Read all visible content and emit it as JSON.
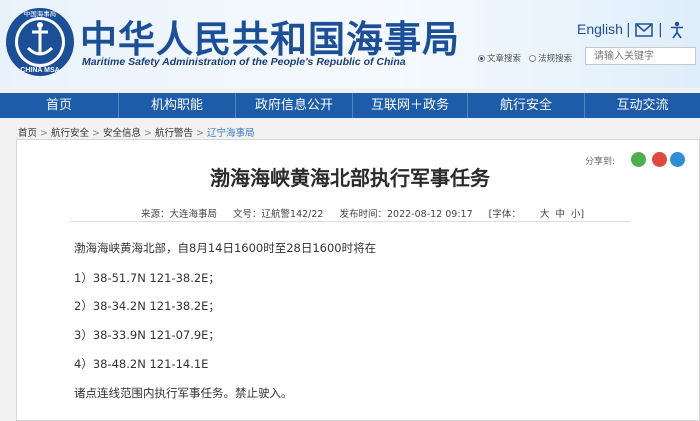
{
  "header": {
    "logo_text": "CHINA MSA",
    "logo_cn": "中国海事局",
    "title_cn": "中华人民共和国海事局",
    "title_en": "Maritime Safety Administration of the People's Republic of China",
    "lang_label": "English",
    "separator": "|",
    "search": {
      "option_fulltext": "文章搜索",
      "option_regulations": "法规搜索",
      "placeholder": "请输入关键字"
    }
  },
  "nav": {
    "items": [
      "首页",
      "机构职能",
      "政府信息公开",
      "互联网＋政务",
      "航行安全",
      "互动交流"
    ]
  },
  "breadcrumb": {
    "items": [
      "首页",
      "航行安全",
      "安全信息",
      "航行警告",
      "辽宁海事局"
    ],
    "separator": ">"
  },
  "article": {
    "share_label": "分享到:",
    "title": "渤海海峡黄海北部执行军事任务",
    "meta": {
      "source": "来源：大连海事局",
      "doc_no": "文号：辽航警142/22",
      "published": "发布时间：2022-08-12 09:17",
      "font_label": "[字体：",
      "font_large": "大",
      "font_medium": "中",
      "font_small": "小",
      "font_close": "]"
    },
    "paragraphs": [
      "渤海海峡黄海北部，自8月14日1600时至28日1600时将在",
      "1）38-51.7N    121-38.2E；",
      "2）38-34.2N    121-38.2E；",
      "3）38-33.9N    121-07.9E；",
      "4）38-48.2N    121-14.1E",
      "诸点连线范围内执行军事任务。禁止驶入。"
    ]
  },
  "colors": {
    "brand_blue": "#1c5ca8",
    "title_blue": "#1b4f98"
  }
}
